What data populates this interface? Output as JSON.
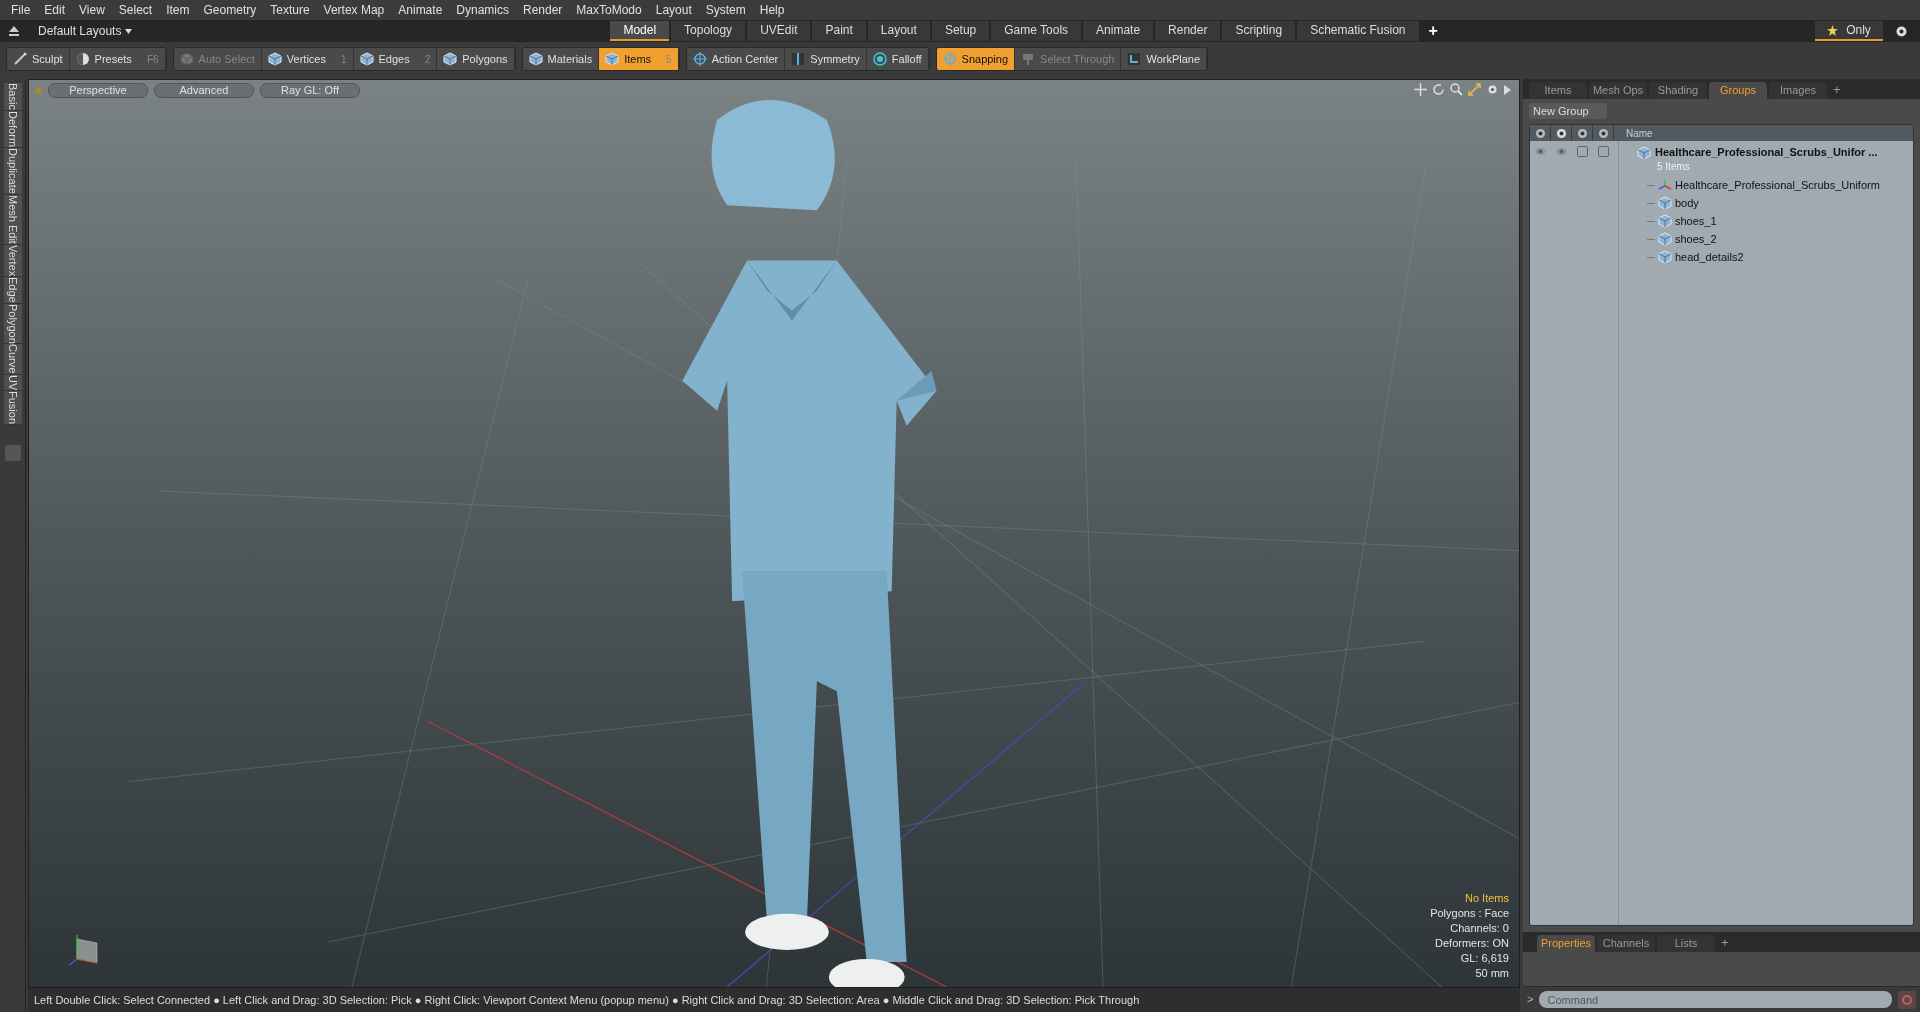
{
  "menu": [
    "File",
    "Edit",
    "View",
    "Select",
    "Item",
    "Geometry",
    "Texture",
    "Vertex Map",
    "Animate",
    "Dynamics",
    "Render",
    "MaxToModo",
    "Layout",
    "System",
    "Help"
  ],
  "layout_selector": "Default Layouts",
  "layout_tabs": [
    {
      "label": "Model",
      "selected": true
    },
    {
      "label": "Topology",
      "selected": false
    },
    {
      "label": "UVEdit",
      "selected": false
    },
    {
      "label": "Paint",
      "selected": false
    },
    {
      "label": "Layout",
      "selected": false
    },
    {
      "label": "Setup",
      "selected": false
    },
    {
      "label": "Game Tools",
      "selected": false
    },
    {
      "label": "Animate",
      "selected": false
    },
    {
      "label": "Render",
      "selected": false
    },
    {
      "label": "Scripting",
      "selected": false
    },
    {
      "label": "Schematic Fusion",
      "selected": false
    }
  ],
  "add_tab": "+",
  "only_button": "Only",
  "toolbar": [
    {
      "label": "Sculpt",
      "on": false,
      "disabled": false
    },
    {
      "label": "Presets",
      "shortcut": "F6",
      "on": false,
      "disabled": false
    },
    {
      "label": "Auto Select",
      "on": false,
      "disabled": true
    },
    {
      "label": "Vertices",
      "shortcut": "1",
      "on": false,
      "disabled": false
    },
    {
      "label": "Edges",
      "shortcut": "2",
      "on": false,
      "disabled": false
    },
    {
      "label": "Polygons",
      "on": false,
      "disabled": false
    },
    {
      "label": "Materials",
      "on": false,
      "disabled": false
    },
    {
      "label": "Items",
      "shortcut": "5",
      "on": true,
      "disabled": false
    },
    {
      "label": "Action Center",
      "on": false,
      "disabled": false
    },
    {
      "label": "Symmetry",
      "on": false,
      "disabled": false
    },
    {
      "label": "Falloff",
      "on": false,
      "disabled": false
    },
    {
      "label": "Snapping",
      "on": true,
      "disabled": false
    },
    {
      "label": "Select Through",
      "on": false,
      "disabled": true
    },
    {
      "label": "WorkPlane",
      "on": false,
      "disabled": false
    }
  ],
  "side_tabs": [
    "Basic",
    "Deform",
    "Duplicate",
    "Mesh Edit",
    "Vertex",
    "Edge",
    "Polygon",
    "Curve",
    "UV",
    "Fusion"
  ],
  "viewport": {
    "buttons": [
      "Perspective",
      "Advanced",
      "Ray GL: Off"
    ],
    "info": [
      {
        "text": "No Items",
        "highlight": true
      },
      {
        "text": "Polygons : Face",
        "highlight": false
      },
      {
        "text": "Channels: 0",
        "highlight": false
      },
      {
        "text": "Deformers: ON",
        "highlight": false
      },
      {
        "text": "GL: 6,619",
        "highlight": false
      },
      {
        "text": "50 mm",
        "highlight": false
      }
    ]
  },
  "right_panel": {
    "tabs": [
      {
        "label": "Items",
        "selected": false
      },
      {
        "label": "Mesh Ops",
        "selected": false
      },
      {
        "label": "Shading",
        "selected": false
      },
      {
        "label": "Groups",
        "selected": true
      },
      {
        "label": "Images",
        "selected": false
      }
    ],
    "add_tab": "+",
    "new_group_button": "New Group",
    "column_header": "Name",
    "tree": [
      {
        "name": "Healthcare_Professional_Scrubs_Unifor ...",
        "subtitle": "5 Items",
        "kind": "group",
        "toggles": [
          {
            "checked": false
          },
          {
            "checked": false
          }
        ],
        "children": [
          {
            "name": "Healthcare_Professional_Scrubs_Uniform",
            "kind": "locator"
          },
          {
            "name": "body",
            "kind": "mesh"
          },
          {
            "name": "shoes_1",
            "kind": "mesh"
          },
          {
            "name": "shoes_2",
            "kind": "mesh"
          },
          {
            "name": "head_details2",
            "kind": "mesh"
          }
        ]
      }
    ],
    "bottom_tabs": [
      {
        "label": "Properties",
        "selected": true
      },
      {
        "label": "Channels",
        "selected": false
      },
      {
        "label": "Lists",
        "selected": false
      }
    ],
    "bottom_add_tab": "+",
    "command": {
      "prompt": ">",
      "placeholder": "Command"
    }
  },
  "status_bar": "Left Double Click: Select Connected ● Left Click and Drag: 3D Selection: Pick ● Right Click: Viewport Context Menu (popup menu) ● Right Click and Drag: 3D Selection: Area ● Middle Click and Drag: 3D Selection: Pick Through"
}
